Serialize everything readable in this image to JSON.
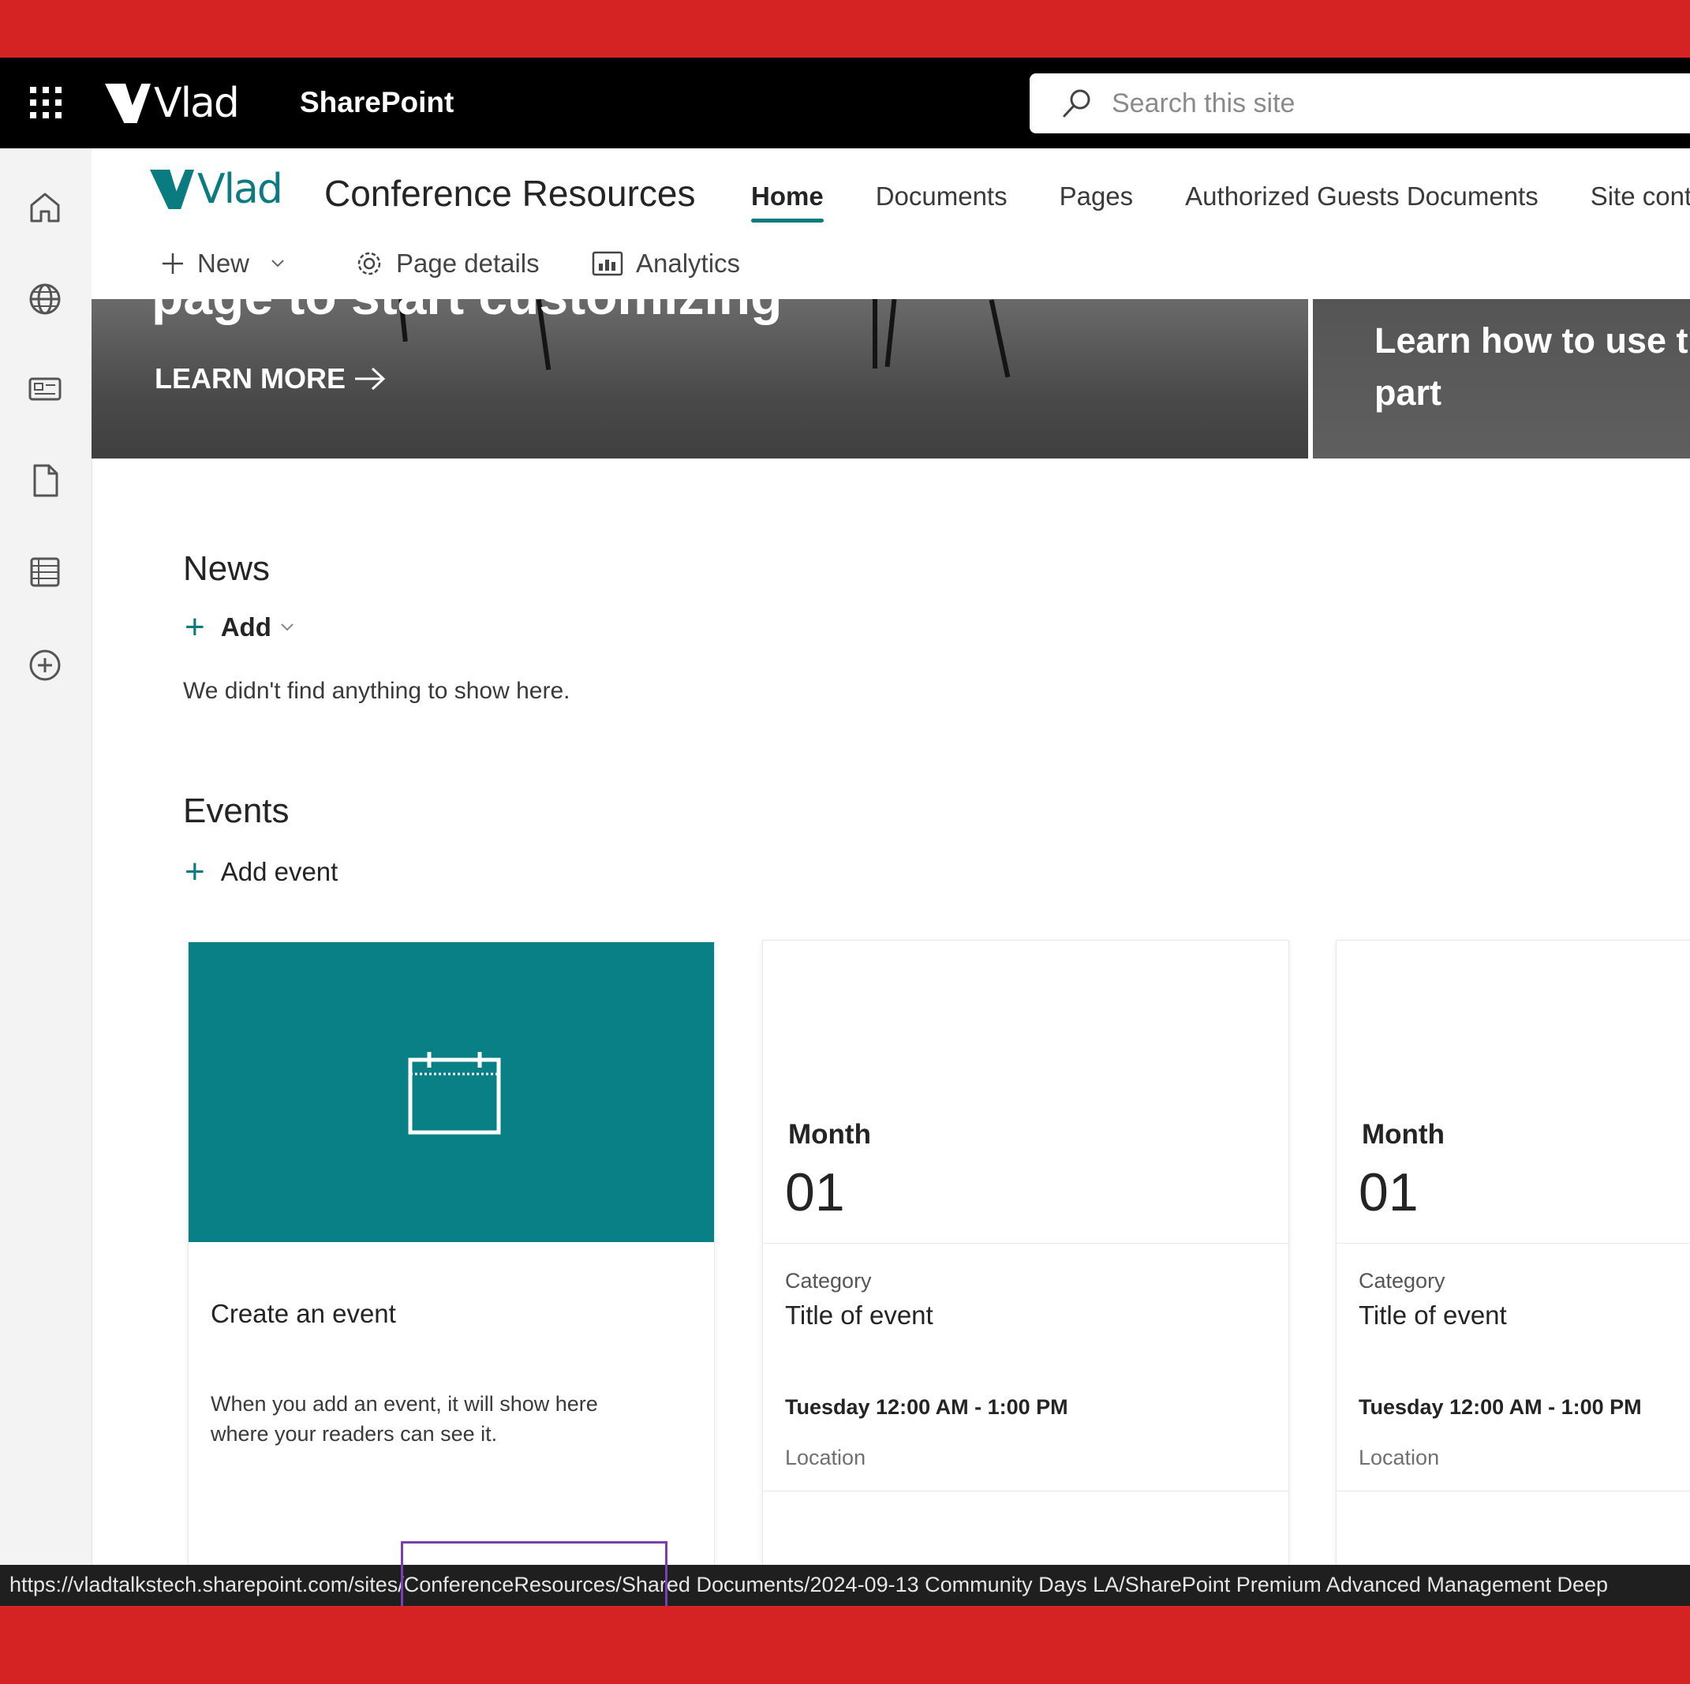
{
  "suite": {
    "brand": "Vlad",
    "app_name": "SharePoint",
    "search_placeholder": "Search this site"
  },
  "site": {
    "logo_text": "Vlad",
    "title": "Conference Resources",
    "nav": [
      "Home",
      "Documents",
      "Pages",
      "Authorized Guests Documents",
      "Site conte"
    ],
    "active_nav": "Home"
  },
  "commands": {
    "new": "New",
    "page_details": "Page details",
    "analytics": "Analytics"
  },
  "hero": {
    "left_title": "page to start customizing",
    "learn_more": "LEARN MORE",
    "right_title": "Learn how to use t web part"
  },
  "news": {
    "heading": "News",
    "add": "Add",
    "empty": "We didn't find anything to show here."
  },
  "events": {
    "heading": "Events",
    "add": "Add event",
    "create_card": {
      "title": "Create an event",
      "description": "When you add an event, it will show here where your readers can see it."
    },
    "items": [
      {
        "month": "Month",
        "day": "01",
        "category": "Category",
        "title": "Title of event",
        "time": "Tuesday 12:00 AM - 1:00 PM",
        "location": "Location"
      },
      {
        "month": "Month",
        "day": "01",
        "category": "Category",
        "title": "Title of event",
        "time": "Tuesday 12:00 AM - 1:00 PM",
        "location": "Location"
      }
    ]
  },
  "status_url": "https://vladtalkstech.sharepoint.com/sites/ConferenceResources/Shared Documents/2024-09-13 Community Days LA/SharePoint Premium Advanced Management Deep",
  "colors": {
    "frame_red": "#d42322",
    "accent_teal": "#088086",
    "suite_bar": "#000000"
  }
}
